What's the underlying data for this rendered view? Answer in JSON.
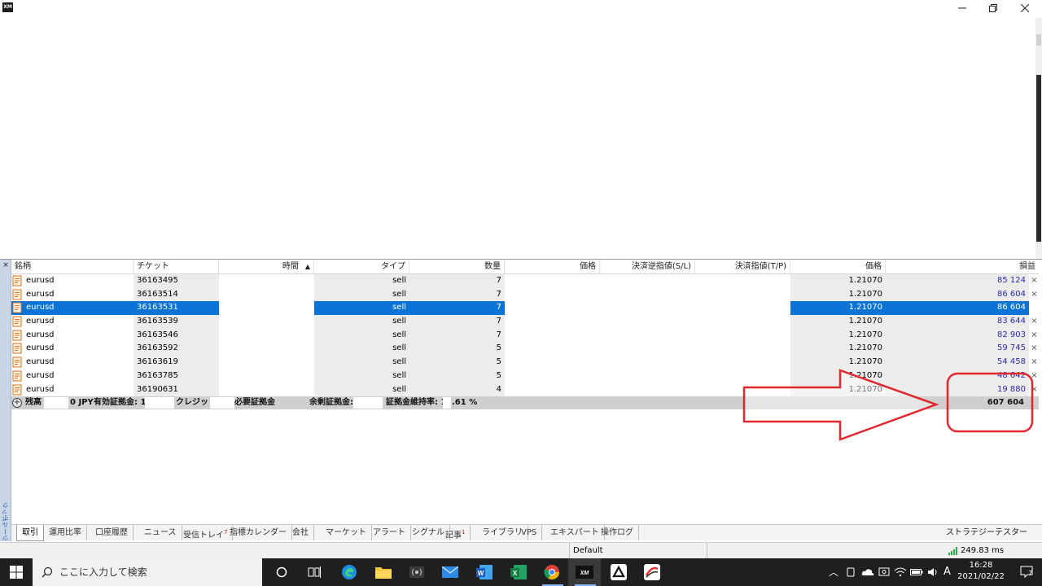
{
  "window": {
    "logo_text": "XM"
  },
  "columns": {
    "symbol": "銘柄",
    "ticket": "チケット",
    "time": "時間",
    "type": "タイプ",
    "volume": "数量",
    "price": "価格",
    "sl": "決済逆指値(S/L)",
    "tp": "決済指値(T/P)",
    "price2": "価格",
    "profit": "損益"
  },
  "trades": [
    {
      "symbol": "eurusd",
      "ticket": "36163495",
      "type": "sell",
      "volume": "7",
      "current_price": "1.21070",
      "profit": "85 124",
      "close": "×"
    },
    {
      "symbol": "eurusd",
      "ticket": "36163514",
      "type": "sell",
      "volume": "7",
      "current_price": "1.21070",
      "profit": "86 604",
      "close": "×"
    },
    {
      "symbol": "eurusd",
      "ticket": "36163531",
      "type": "sell",
      "volume": "7",
      "current_price": "1.21070",
      "profit": "86 604",
      "close": "×"
    },
    {
      "symbol": "eurusd",
      "ticket": "36163539",
      "type": "sell",
      "volume": "7",
      "current_price": "1.21070",
      "profit": "83 644",
      "close": "×"
    },
    {
      "symbol": "eurusd",
      "ticket": "36163546",
      "type": "sell",
      "volume": "7",
      "current_price": "1.21070",
      "profit": "82 903",
      "close": "×"
    },
    {
      "symbol": "eurusd",
      "ticket": "36163592",
      "type": "sell",
      "volume": "5",
      "current_price": "1.21070",
      "profit": "59 745",
      "close": "×"
    },
    {
      "symbol": "eurusd",
      "ticket": "36163619",
      "type": "sell",
      "volume": "5",
      "current_price": "1.21070",
      "profit": "54 458",
      "close": "×"
    },
    {
      "symbol": "eurusd",
      "ticket": "36163785",
      "type": "sell",
      "volume": "5",
      "current_price": "1.21070",
      "profit": "48 642",
      "close": "×"
    },
    {
      "symbol": "eurusd",
      "ticket": "36190631",
      "type": "sell",
      "volume": "4",
      "current_price": "1.21070",
      "profit": "19 880",
      "close": "×"
    }
  ],
  "selected_row_index": 2,
  "summary": {
    "balance_label": "残高",
    "balance_suffix": "0 JPY",
    "equity_label": "有効証拠金: 1",
    "credit_label": "クレジット:",
    "margin_label": "必要証拠金",
    "free_margin_label": "余剰証拠金:",
    "margin_level_label": "証拠金維持率: 1",
    "margin_level_suffix": ".61 %",
    "total_profit": "607 604"
  },
  "toolbox_label": "ツールボックス",
  "side_close": "×",
  "tabs": [
    {
      "label": "取引",
      "badge": ""
    },
    {
      "label": "運用比率",
      "badge": ""
    },
    {
      "label": "口座履歴",
      "badge": ""
    },
    {
      "label": "ニュース",
      "badge": ""
    },
    {
      "label": "受信トレイ",
      "badge": "7"
    },
    {
      "label": "指標カレンダー",
      "badge": ""
    },
    {
      "label": "会社",
      "badge": ""
    },
    {
      "label": "マーケット",
      "badge": ""
    },
    {
      "label": "アラート",
      "badge": ""
    },
    {
      "label": "シグナル",
      "badge": ""
    },
    {
      "label": "記事",
      "badge": "1"
    },
    {
      "label": "ライブラリ",
      "badge": ""
    },
    {
      "label": "VPS",
      "badge": ""
    },
    {
      "label": "エキスパート",
      "badge": ""
    },
    {
      "label": "操作ログ",
      "badge": ""
    }
  ],
  "strategy_tester": "ストラテジーテスター",
  "statusbar": {
    "profile": "Default",
    "connection": "249.83 ms"
  },
  "taskbar": {
    "search_placeholder": "ここに入力して検索",
    "ime": "A",
    "time": "16:28",
    "date": "2021/02/22",
    "notif_count": "7"
  },
  "colors": {
    "selection": "#0a73d6",
    "profit": "#2b2ba8",
    "annotation": "#e0282e"
  }
}
